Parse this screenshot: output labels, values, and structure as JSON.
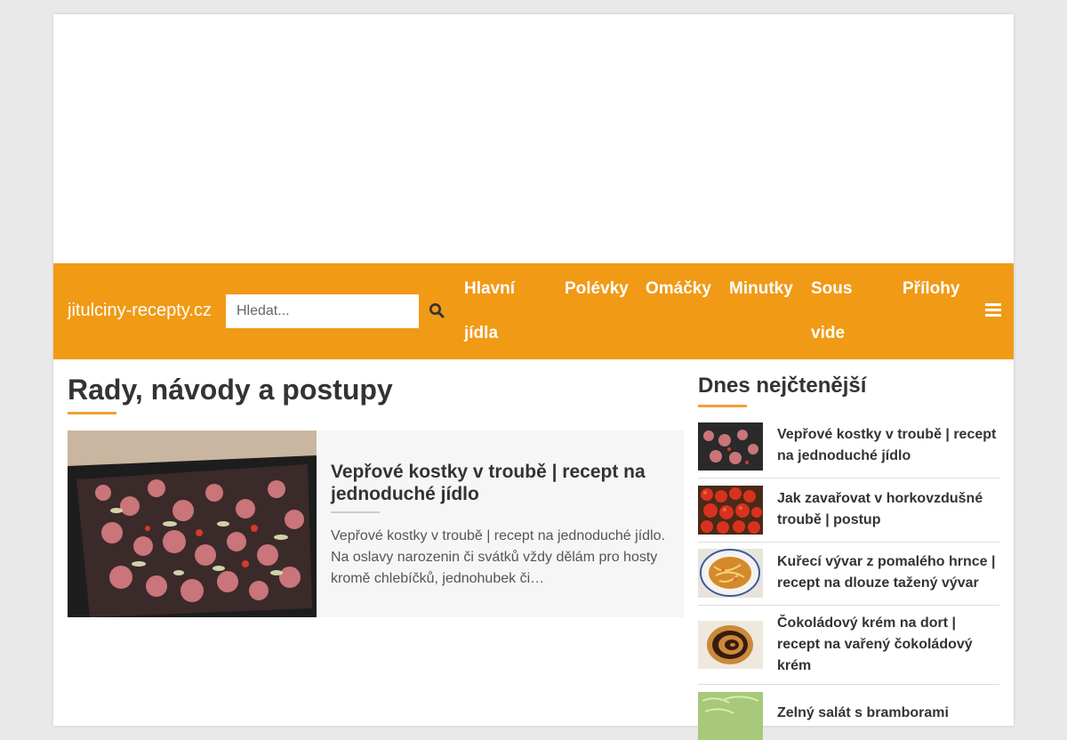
{
  "header": {
    "brand": "jitulciny-recepty.cz",
    "search_placeholder": "Hledat...",
    "nav": [
      {
        "label": "Hlavní",
        "label2": "jídla"
      },
      {
        "label": "Polévky"
      },
      {
        "label": "Omáčky"
      },
      {
        "label": "Minutky"
      },
      {
        "label": "Sous",
        "label2": "vide"
      },
      {
        "label": "Přílohy"
      }
    ],
    "icons": {
      "search": "search-icon",
      "menu": "hamburger-menu-icon"
    }
  },
  "main": {
    "title": "Rady, návody a postupy",
    "article": {
      "title": "Vepřové kostky v troubě | recept na jednoduché jídlo",
      "excerpt": "Vepřové kostky v troubě | recept na jednoduché jídlo. Na oslavy narozenin či svátků vždy dělám pro hosty kromě chlebíčků, jednohubek či…"
    }
  },
  "sidebar": {
    "title": "Dnes nejčtenější",
    "items": [
      {
        "title": "Vepřové kostky v troubě | recept na jednoduché jídlo"
      },
      {
        "title": "Jak zavařovat v horkovzdušné troubě | postup"
      },
      {
        "title": "Kuřecí vývar z pomalého hrnce | recept na dlouze tažený vývar"
      },
      {
        "title": "Čokoládový krém na dort | recept na vařený čokoládový krém"
      },
      {
        "title": "Zelný salát s bramborami"
      }
    ]
  },
  "colors": {
    "accent": "#f09a16",
    "underline": "#f0a13a"
  }
}
